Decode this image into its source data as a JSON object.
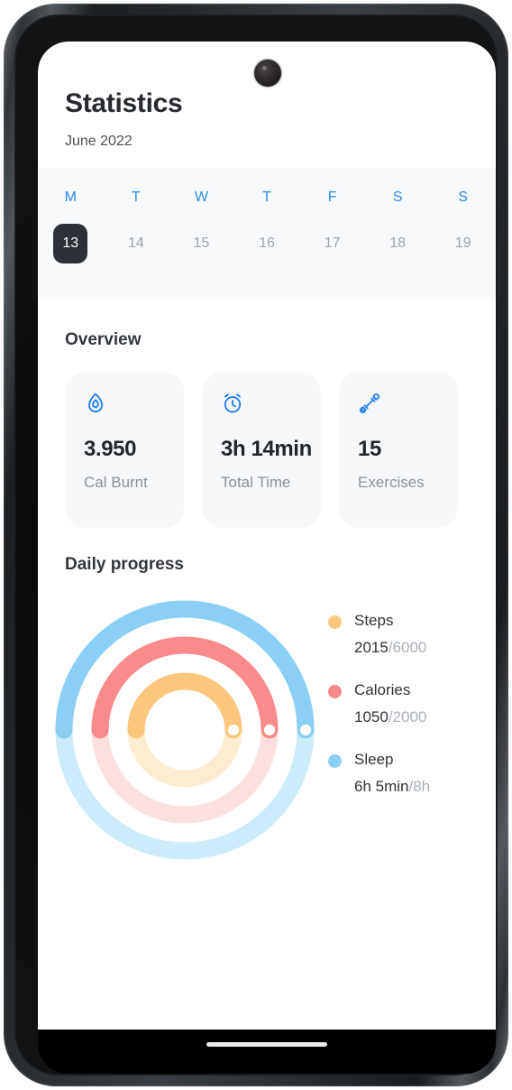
{
  "header": {
    "title": "Statistics",
    "subtitle": "June 2022"
  },
  "date_strip": {
    "days": [
      {
        "letter": "M",
        "date": "13",
        "selected": true
      },
      {
        "letter": "T",
        "date": "14",
        "selected": false
      },
      {
        "letter": "W",
        "date": "15",
        "selected": false
      },
      {
        "letter": "T",
        "date": "16",
        "selected": false
      },
      {
        "letter": "F",
        "date": "17",
        "selected": false
      },
      {
        "letter": "S",
        "date": "18",
        "selected": false
      },
      {
        "letter": "S",
        "date": "19",
        "selected": false
      }
    ],
    "day_letter_color": "#2a8cf0",
    "selected_chip_color": "#2b3137",
    "background": "#f7f9fb"
  },
  "overview": {
    "title": "Overview",
    "cards": [
      {
        "icon": "flame-icon",
        "value": "3.950",
        "label": "Cal Burnt"
      },
      {
        "icon": "alarm-clock-icon",
        "value": "3h 14min",
        "label": "Total Time"
      },
      {
        "icon": "dumbbell-icon",
        "value": "15",
        "label": "Exercises"
      }
    ],
    "icon_color": "#1b7ced",
    "card_background": "#f7f8fa"
  },
  "daily_progress": {
    "title": "Daily progress",
    "legend": [
      {
        "name": "Steps",
        "current": "2015",
        "separator": "/",
        "goal": "6000",
        "color": "#fbc77d"
      },
      {
        "name": "Calories",
        "current": "1050",
        "separator": "/",
        "goal": "2000",
        "color": "#f98b8b"
      },
      {
        "name": "Sleep",
        "current": "6h 5min",
        "separator": "/",
        "goal": "8h",
        "color": "#8bd0f4"
      }
    ]
  },
  "chart_data": {
    "type": "pie",
    "title": "Daily progress",
    "subtype": "concentric-progress-rings",
    "start_angle_deg": 180,
    "sweep_direction": "clockwise",
    "series": [
      {
        "name": "Sleep",
        "ring": "outer",
        "value": 6.0833,
        "goal": 8,
        "value_label": "6h 5min",
        "goal_label": "8h",
        "fraction": 0.5,
        "sweep_deg": 180,
        "color": "#8bd0f4",
        "track_color": "#cdecfb",
        "radius": 134,
        "stroke_width": 19
      },
      {
        "name": "Calories",
        "ring": "middle",
        "value": 1050,
        "goal": 2000,
        "value_label": "1050",
        "goal_label": "2000",
        "fraction": 0.5,
        "sweep_deg": 180,
        "color": "#f98b8b",
        "track_color": "#fce0e0",
        "radius": 94,
        "stroke_width": 19
      },
      {
        "name": "Steps",
        "ring": "inner",
        "value": 2015,
        "goal": 6000,
        "value_label": "2015",
        "goal_label": "6000",
        "fraction": 0.5,
        "sweep_deg": 180,
        "color": "#fbc77d",
        "track_color": "#fdeccf",
        "radius": 54,
        "stroke_width": 19
      }
    ],
    "endpoint_marker": "white-dot",
    "legend_position": "right"
  }
}
